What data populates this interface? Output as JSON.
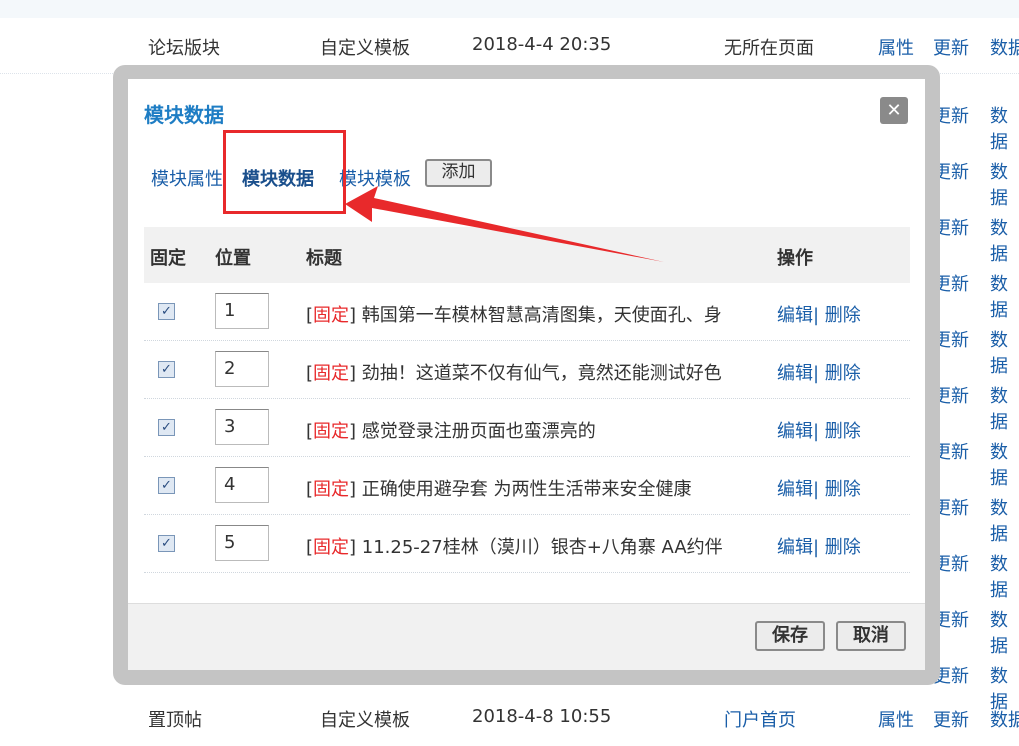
{
  "background": {
    "top_row": {
      "name": "论坛版块",
      "template": "自定义模板",
      "date": "2018-4-4 20:35",
      "page": "无所在页面",
      "attr": "属性",
      "update": "更新",
      "data": "数据"
    },
    "bottom_row": {
      "name": "置顶帖",
      "template": "自定义模板",
      "date": "2018-4-8 10:55",
      "page": "门户首页",
      "attr": "属性",
      "update": "更新",
      "data": "数据"
    },
    "right_update": "更新",
    "right_data": "数据"
  },
  "dialog": {
    "title": "模块数据",
    "close_icon": "close-icon",
    "tabs": [
      "模块属性",
      "模块数据",
      "模块模板"
    ],
    "add_label": "添加",
    "columns": {
      "fixed": "固定",
      "position": "位置",
      "title": "标题",
      "action": "操作"
    },
    "fixed_tag": "固定",
    "edit_label": "编辑",
    "delete_label": "删除",
    "rows": [
      {
        "checked": true,
        "position": "1",
        "title": "韩国第一车模林智慧高清图集，天使面孔、身"
      },
      {
        "checked": true,
        "position": "2",
        "title": "劲抽！这道菜不仅有仙气，竟然还能测试好色"
      },
      {
        "checked": true,
        "position": "3",
        "title": "感觉登录注册页面也蛮漂亮的"
      },
      {
        "checked": true,
        "position": "4",
        "title": "正确使用避孕套 为两性生活带来安全健康"
      },
      {
        "checked": true,
        "position": "5",
        "title": "11.25-27桂林（漠川）银杏+八角寨 AA约伴"
      }
    ],
    "save_label": "保存",
    "cancel_label": "取消"
  },
  "annotation": {
    "color": "#e8292b"
  }
}
